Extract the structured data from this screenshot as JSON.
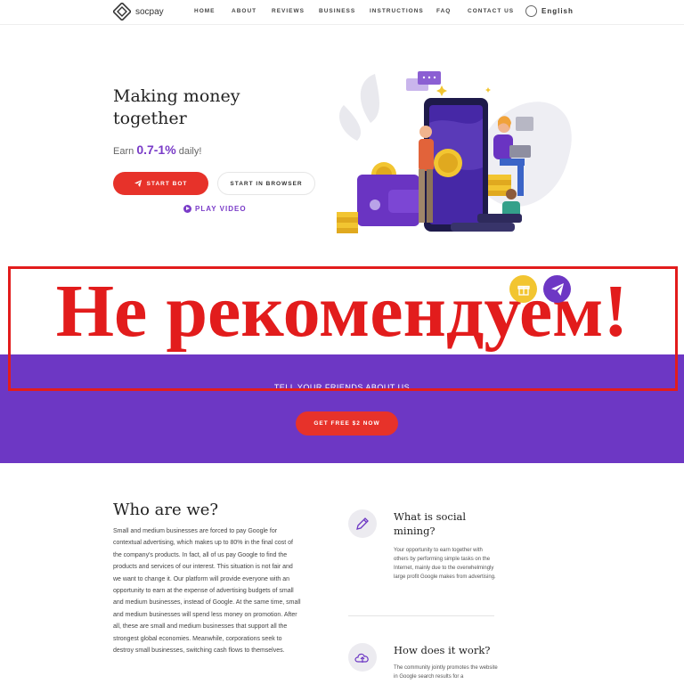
{
  "header": {
    "logo_text": "socpay",
    "nav": [
      "HOME",
      "ABOUT",
      "REVIEWS",
      "BUSINESS",
      "INSTRUCTIONS",
      "FAQ",
      "CONTACT US"
    ],
    "language": "English"
  },
  "hero": {
    "title": "Making money together",
    "earn_prefix": "Earn",
    "earn_rate": "0.7-1%",
    "earn_suffix": "daily!",
    "start_bot_label": "START BOT",
    "start_browser_label": "START IN BROWSER",
    "play_video_label": "PLAY VIDEO"
  },
  "overlay": {
    "warning_text": "Не рекомендуем!"
  },
  "referral": {
    "text": "TELL YOUR FRIENDS ABOUT US",
    "button_label": "GET FREE $2 NOW"
  },
  "about": {
    "title": "Who are we?",
    "body": "Small and medium businesses are forced to pay Google for contextual advertising, which makes up to 80% in the final cost of the company's products. In fact, all of us pay Google to find the products and services of our interest. This situation is not fair and we want to change it. Our platform will provide everyone with an opportunity to earn at the expense of advertising budgets of small and medium businesses, instead of Google. At the same time, small and medium businesses will spend less money on promotion. After all, these are small and medium businesses that support all the strongest global economies. Meanwhile, corporations seek to destroy small businesses, switching cash flows to themselves."
  },
  "features": [
    {
      "title": "What is social mining?",
      "body": "Your opportunity to earn together with others by performing simple tasks on the Internet, mainly due to the overwhelmingly large profit Google makes from advertising.",
      "icon": "pencil-icon"
    },
    {
      "title": "How does it work?",
      "body": "The community jointly promotes the website in Google search results for a",
      "icon": "cloud-upload-icon"
    }
  ],
  "colors": {
    "brand_purple": "#6d37c4",
    "accent_red": "#e7322a",
    "warning_red": "#e21c1c",
    "gift_yellow": "#f2c531"
  }
}
